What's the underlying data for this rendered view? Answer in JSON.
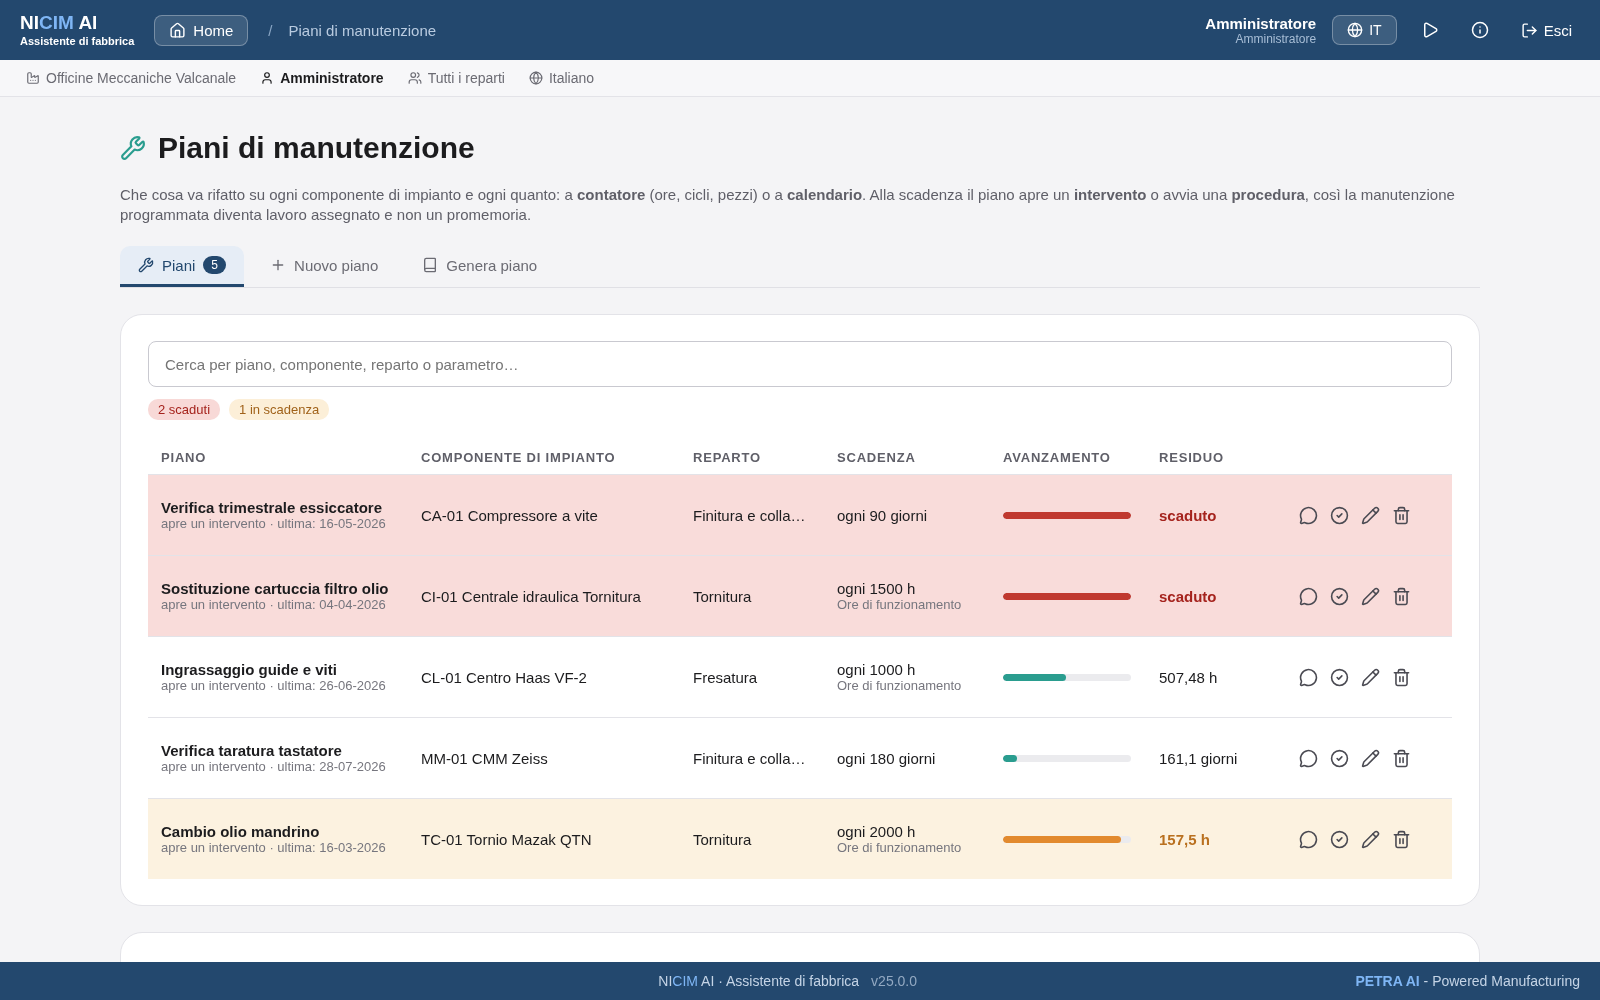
{
  "header": {
    "logo": [
      {
        "text": "NI",
        "accent": false
      },
      {
        "text": "CIM",
        "accent": true
      },
      {
        "text": " AI",
        "accent": false
      }
    ],
    "logo_subtitle": "Assistente di fabbrica",
    "home_button": "Home",
    "breadcrumb_separator": "/",
    "breadcrumb": "Piani di manutenzione",
    "user_name": "Amministratore",
    "user_role": "Amministratore",
    "language": "IT",
    "logout": "Esci"
  },
  "context_bar": [
    {
      "kind": "factory",
      "label": "Officine Meccaniche Valcanale",
      "selected": false
    },
    {
      "kind": "user",
      "label": "Amministratore",
      "selected": true
    },
    {
      "kind": "users",
      "label": "Tutti i reparti",
      "selected": false
    },
    {
      "kind": "globe",
      "label": "Italiano",
      "selected": false
    }
  ],
  "page": {
    "title": "Piani di manutenzione",
    "description": "Che cosa va rifatto su ogni componente di impianto e ogni quanto: a **contatore** (ore, cicli, pezzi) o a **calendario**. Alla scadenza il piano apre un **intervento** o avvia una **procedura**, così la manutenzione programmata diventa lavoro assegnato e non un promemoria."
  },
  "tabs": [
    {
      "kind": "wrench",
      "label": "Piani",
      "badge": "5",
      "selected": true
    },
    {
      "kind": "plus",
      "label": "Nuovo piano",
      "selected": false
    },
    {
      "kind": "book",
      "label": "Genera piano",
      "selected": false
    }
  ],
  "search": {
    "placeholder": "Cerca per piano, componente, reparto o parametro…"
  },
  "filters": [
    {
      "kind": "overdue",
      "label": "2 scaduti"
    },
    {
      "kind": "due_soon",
      "label": "1 in scadenza"
    }
  ],
  "table": {
    "columns": [
      "PIANO",
      "COMPONENTE DI IMPIANTO",
      "REPARTO",
      "SCADENZA",
      "AVANZAMENTO",
      "RESIDUO"
    ],
    "rows": [
      {
        "kind": "overdue",
        "plan": "Verifica trimestrale essiccatore",
        "plan_note": "apre un intervento · ultima: 16-05-2026",
        "component": "CA-01 Compressore a vite",
        "department": "Finitura e colla…",
        "due": "ogni 90 giorni",
        "level": 1,
        "residual": "scaduto"
      },
      {
        "kind": "overdue",
        "plan": "Sostituzione cartuccia filtro olio",
        "plan_note": "apre un intervento · ultima: 04-04-2026",
        "component": "CI-01 Centrale idraulica Tornitura",
        "department": "Tornitura",
        "due": "ogni 1500 h",
        "due_note": "Ore di funzionamento",
        "level": 1,
        "residual": "scaduto"
      },
      {
        "kind": "ok",
        "plan": "Ingrassaggio guide e viti",
        "plan_note": "apre un intervento · ultima: 26-06-2026",
        "component": "CL-01 Centro Haas VF-2",
        "department": "Fresatura",
        "due": "ogni 1000 h",
        "due_note": "Ore di funzionamento",
        "level": 0.49,
        "residual": "507,48 h"
      },
      {
        "kind": "ok",
        "plan": "Verifica taratura tastatore",
        "plan_note": "apre un intervento · ultima: 28-07-2026",
        "component": "MM-01 CMM Zeiss",
        "department": "Finitura e colla…",
        "due": "ogni 180 giorni",
        "level": 0.11,
        "residual": "161,1 giorni"
      },
      {
        "kind": "due_soon",
        "plan": "Cambio olio mandrino",
        "plan_note": "apre un intervento · ultima: 16-03-2026",
        "component": "TC-01 Tornio Mazak QTN",
        "department": "Tornitura",
        "due": "ogni 2000 h",
        "due_note": "Ore di funzionamento",
        "level": 0.92,
        "residual": "157,5 h"
      }
    ]
  },
  "footer": {
    "brand": [
      {
        "text": "NI",
        "accent": false
      },
      {
        "text": "CIM",
        "accent": true
      },
      {
        "text": " AI · Assistente di fabbrica",
        "accent": false
      }
    ],
    "version": "v25.0.0",
    "powered_brand": "PETRA AI",
    "powered_text": " - Powered Manufacturing"
  }
}
